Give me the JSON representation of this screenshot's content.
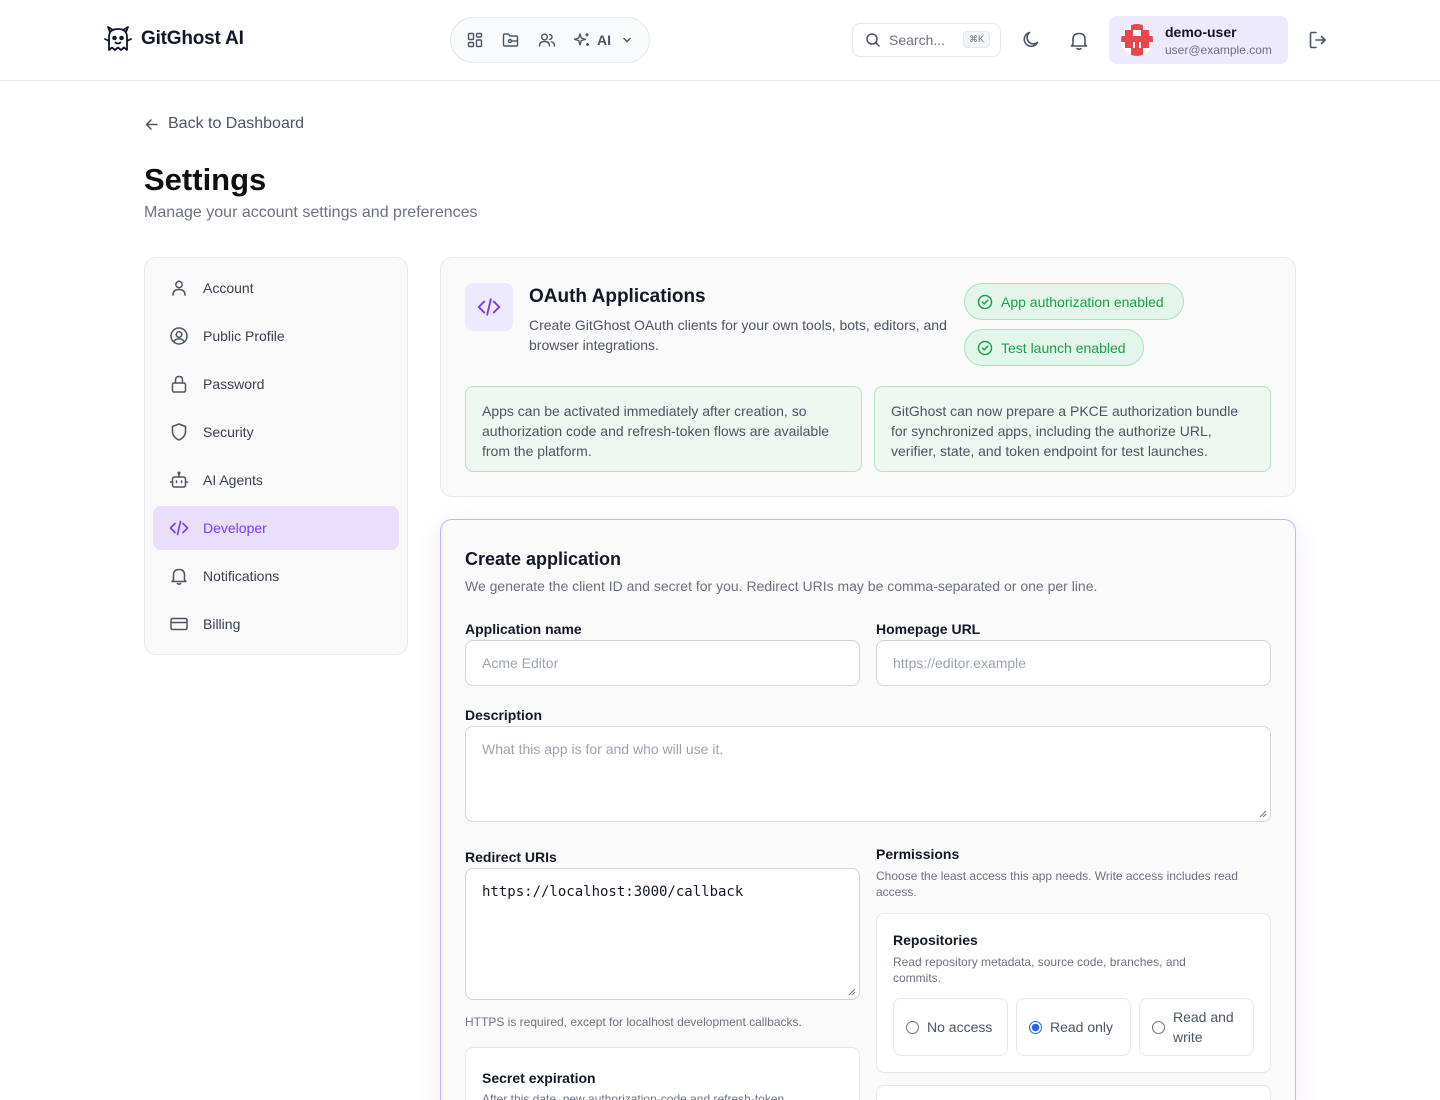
{
  "header": {
    "brand": "GitGhost AI",
    "nav_ai_label": "AI",
    "search_placeholder": "Search...",
    "search_shortcut": "⌘K",
    "user": {
      "name": "demo-user",
      "email": "user@example.com"
    }
  },
  "page": {
    "back_label": "Back to Dashboard",
    "title": "Settings",
    "subtitle": "Manage your account settings and preferences"
  },
  "sidebar": {
    "items": [
      {
        "label": "Account",
        "icon": "user-icon"
      },
      {
        "label": "Public Profile",
        "icon": "user-circle-icon"
      },
      {
        "label": "Password",
        "icon": "lock-icon"
      },
      {
        "label": "Security",
        "icon": "shield-icon"
      },
      {
        "label": "AI Agents",
        "icon": "bot-icon"
      },
      {
        "label": "Developer",
        "icon": "code-icon",
        "active": true
      },
      {
        "label": "Notifications",
        "icon": "bell-icon"
      },
      {
        "label": "Billing",
        "icon": "credit-card-icon"
      }
    ]
  },
  "oauth": {
    "title": "OAuth Applications",
    "description": "Create GitGhost OAuth clients for your own tools, bots, editors, and browser integrations.",
    "badges": [
      "App authorization enabled",
      "Test launch enabled"
    ],
    "info": [
      "Apps can be activated immediately after creation, so authorization code and refresh-token flows are available from the platform.",
      "GitGhost can now prepare a PKCE authorization bundle for synchronized apps, including the authorize URL, verifier, state, and token endpoint for test launches."
    ]
  },
  "create": {
    "title": "Create application",
    "subtitle": "We generate the client ID and secret for you. Redirect URIs may be comma-separated or one per line.",
    "app_name": {
      "label": "Application name",
      "placeholder": "Acme Editor"
    },
    "homepage": {
      "label": "Homepage URL",
      "placeholder": "https://editor.example"
    },
    "description": {
      "label": "Description",
      "placeholder": "What this app is for and who will use it."
    },
    "redirect": {
      "label": "Redirect URIs",
      "value": "https://localhost:3000/callback",
      "hint": "HTTPS is required, except for localhost development callbacks."
    },
    "permissions": {
      "label": "Permissions",
      "hint": "Choose the least access this app needs. Write access includes read access.",
      "repositories": {
        "title": "Repositories",
        "description": "Read repository metadata, source code, branches, and commits.",
        "options": [
          "No access",
          "Read only",
          "Read and write"
        ],
        "selected": "Read only"
      }
    },
    "secret_expiration": {
      "title": "Secret expiration",
      "description": "After this date, new authorization-code and refresh-token"
    }
  },
  "colors": {
    "accent": "#7c3aed",
    "success": "#16a34a",
    "radio": "#2563eb"
  }
}
